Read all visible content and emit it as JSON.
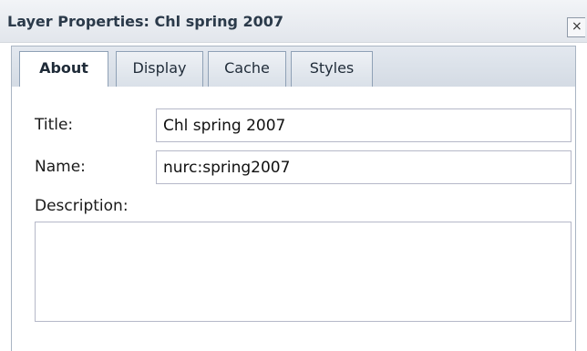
{
  "window": {
    "title": "Layer Properties: Chl spring 2007",
    "close_label": "×"
  },
  "tabs": [
    {
      "label": "About",
      "active": true
    },
    {
      "label": "Display",
      "active": false
    },
    {
      "label": "Cache",
      "active": false
    },
    {
      "label": "Styles",
      "active": false
    }
  ],
  "form": {
    "title_label": "Title:",
    "title_value": "Chl spring 2007",
    "name_label": "Name:",
    "name_value": "nurc:spring2007",
    "description_label": "Description:",
    "description_value": ""
  }
}
